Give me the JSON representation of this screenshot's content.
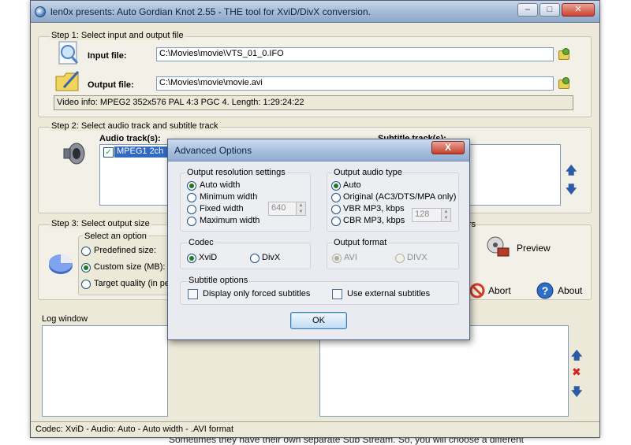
{
  "window": {
    "title": "len0x presents: Auto Gordian Knot 2.55 - THE tool for XviD/DivX conversion."
  },
  "step1": {
    "title": "Step 1: Select input and output file",
    "input_label": "Input file:",
    "input_value": "C:\\Movies\\movie\\VTS_01_0.IFO",
    "output_label": "Output file:",
    "output_value": "C:\\Movies\\movie\\movie.avi",
    "video_info": "Video info: MPEG2 352x576 PAL 4:3   PGC 4. Length: 1:29:24:22"
  },
  "step2": {
    "title": "Step 2: Select audio track and subtitle track",
    "audio_label": "Audio track(s):",
    "audio_item": "MPEG1 2ch",
    "subtitle_label": "Subtitle track(s):"
  },
  "step3": {
    "title": "Step 3: Select output size",
    "option_label": "Select an option",
    "predefined": "Predefined size:",
    "custom": "Custom size (MB):",
    "target": "Target quality (in pe",
    "rs_fragment": "rs"
  },
  "buttons": {
    "preview": "Preview",
    "abort": "Abort",
    "about": "About"
  },
  "log": {
    "title": "Log window"
  },
  "statusbar": {
    "text": "Codec: XviD -  Audio: Auto -  Auto width - .AVI format"
  },
  "dialog": {
    "title": "Advanced Options",
    "close": "X",
    "resolution": {
      "title": "Output resolution settings",
      "auto_width": "Auto width",
      "min_width": "Minimum width",
      "fixed_width": "Fixed width",
      "max_width": "Maximum width",
      "width_value": "640"
    },
    "audio_type": {
      "title": "Output audio type",
      "auto": "Auto",
      "original": "Original (AC3/DTS/MPA only)",
      "vbr": "VBR MP3, kbps",
      "cbr": "CBR MP3, kbps",
      "kbps_value": "128"
    },
    "codec": {
      "title": "Codec",
      "xvid": "XviD",
      "divx": "DivX"
    },
    "output_format": {
      "title": "Output format",
      "avi": "AVI",
      "divx": "DIVX"
    },
    "subtitles": {
      "title": "Subtitle options",
      "forced": "Display only forced subtitles",
      "external": "Use external subtitles"
    },
    "ok": "OK"
  },
  "background_text": "Sometimes they have their own separate Sub Stream. So, you will choose a different"
}
